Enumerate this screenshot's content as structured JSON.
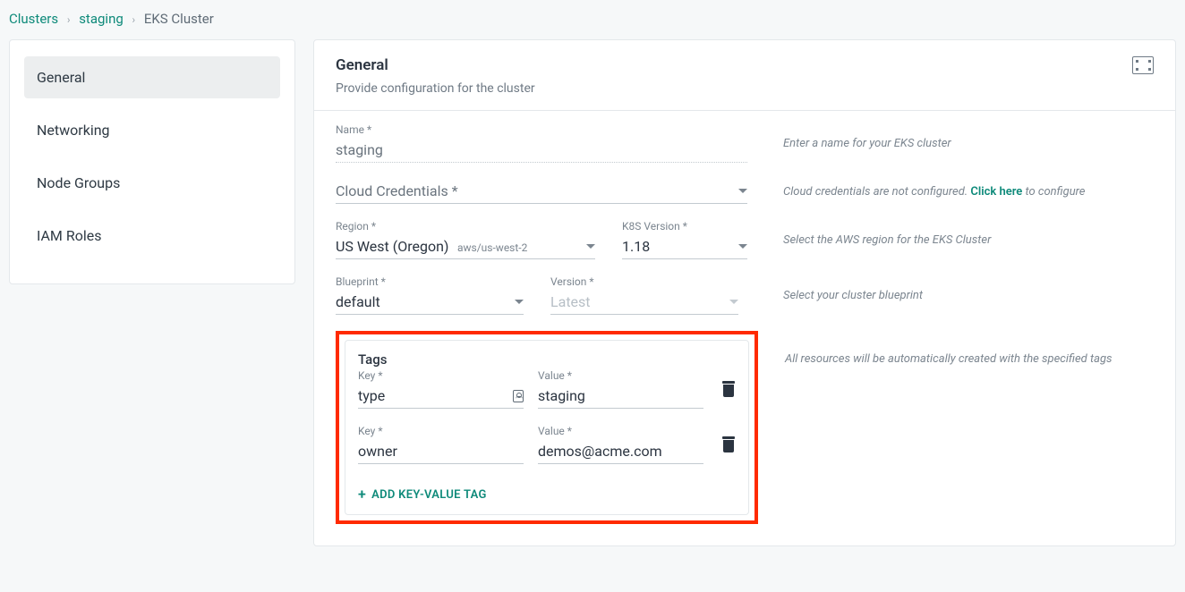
{
  "breadcrumb": {
    "root": "Clusters",
    "env": "staging",
    "current": "EKS Cluster"
  },
  "sidebar": {
    "items": [
      {
        "label": "General",
        "active": true
      },
      {
        "label": "Networking",
        "active": false
      },
      {
        "label": "Node Groups",
        "active": false
      },
      {
        "label": "IAM Roles",
        "active": false
      }
    ]
  },
  "header": {
    "title": "General",
    "subtitle": "Provide configuration for the cluster"
  },
  "form": {
    "name": {
      "label": "Name *",
      "value": "staging",
      "hint": "Enter a name for your EKS cluster"
    },
    "credentials": {
      "label": "Cloud Credentials *",
      "hint_prefix": "Cloud credentials are not configured. ",
      "hint_link": "Click here",
      "hint_suffix": " to configure"
    },
    "region": {
      "label": "Region *",
      "value": "US West (Oregon)",
      "sub": "aws/us-west-2"
    },
    "k8s_version": {
      "label": "K8S Version *",
      "value": "1.18"
    },
    "region_hint": "Select the AWS region for the EKS Cluster",
    "blueprint": {
      "label": "Blueprint *",
      "value": "default"
    },
    "bp_version": {
      "label": "Version *",
      "value": "Latest"
    },
    "blueprint_hint": "Select your cluster blueprint"
  },
  "tags": {
    "title": "Tags",
    "key_label": "Key *",
    "value_label": "Value *",
    "rows": [
      {
        "key": "type",
        "value": "staging"
      },
      {
        "key": "owner",
        "value": "demos@acme.com"
      }
    ],
    "add_label": "ADD KEY-VALUE TAG",
    "hint": "All resources will be automatically created with the specified tags"
  }
}
